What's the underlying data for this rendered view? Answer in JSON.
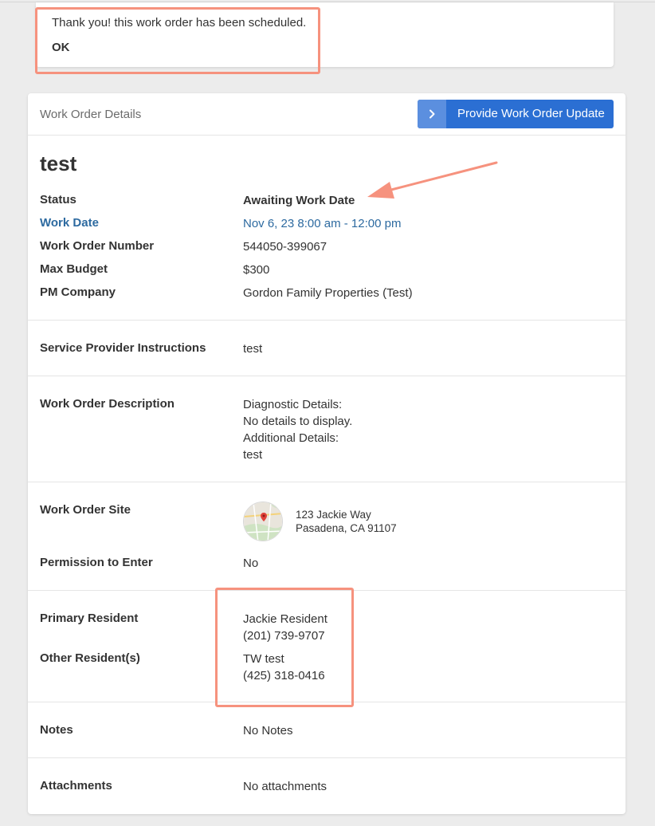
{
  "toast": {
    "message": "Thank you! this work order has been scheduled.",
    "ok_label": "OK"
  },
  "card": {
    "header_title": "Work Order Details",
    "update_button_label": "Provide Work Order Update",
    "update_button_icon": "chevron-right-icon"
  },
  "work_order": {
    "title": "test",
    "status_label": "Status",
    "status_value": "Awaiting Work Date",
    "work_date_label": "Work Date",
    "work_date_value": "Nov 6, 23 8:00 am - 12:00 pm",
    "number_label": "Work Order Number",
    "number_value": "544050-399067",
    "budget_label": "Max Budget",
    "budget_value": "$300",
    "pm_label": "PM Company",
    "pm_value": "Gordon Family Properties (Test)"
  },
  "instructions": {
    "label": "Service Provider Instructions",
    "value": "test"
  },
  "description": {
    "label": "Work Order Description",
    "lines": [
      "Diagnostic Details:",
      "No details to display.",
      "Additional Details:",
      "test"
    ]
  },
  "site": {
    "label": "Work Order Site",
    "address_line1": "123 Jackie Way",
    "address_line2": "Pasadena, CA 91107",
    "map_icon": "map-thumbnail",
    "permission_label": "Permission to Enter",
    "permission_value": "No"
  },
  "residents": {
    "primary_label": "Primary Resident",
    "primary_name": "Jackie Resident",
    "primary_phone": "(201) 739-9707",
    "other_label": "Other Resident(s)",
    "other_name": "TW test",
    "other_phone": "(425) 318-0416"
  },
  "notes": {
    "label": "Notes",
    "value": "No Notes"
  },
  "attachments": {
    "label": "Attachments",
    "value": "No attachments"
  },
  "colors": {
    "page_bg": "#ececec",
    "card_bg": "#ffffff",
    "primary_button": "#2b6fd3",
    "link": "#2d6aa0",
    "annotation": "#f6927e"
  }
}
